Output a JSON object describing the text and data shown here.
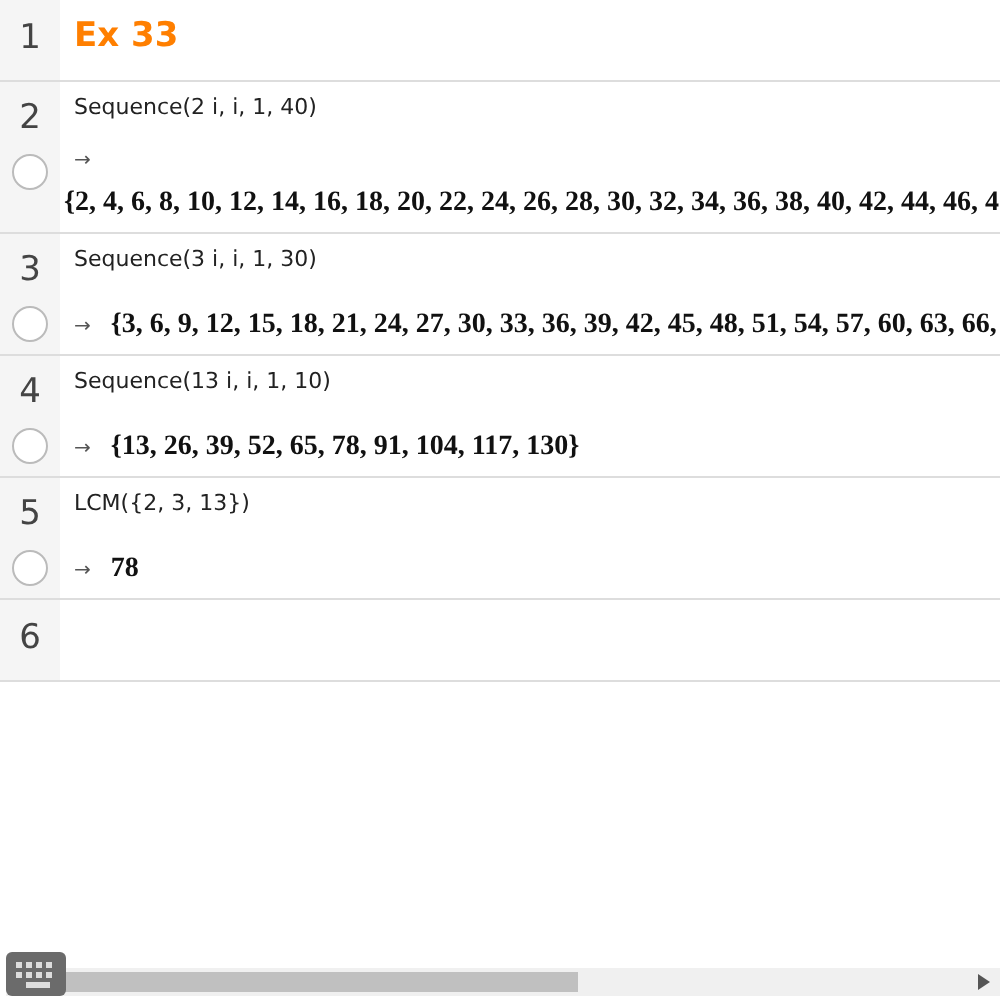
{
  "rows": [
    {
      "number": "1",
      "kind": "text",
      "text": "Ex 33"
    },
    {
      "number": "2",
      "kind": "cas",
      "input": "Sequence(2 i, i, 1, 40)",
      "arrow": "→",
      "output": "{2, 4, 6, 8, 10, 12, 14, 16, 18, 20, 22, 24, 26, 28, 30, 32, 34, 36, 38, 40, 42, 44, 46, 4",
      "output_below": true,
      "plotted": false
    },
    {
      "number": "3",
      "kind": "cas",
      "input": "Sequence(3 i, i, 1, 30)",
      "arrow": "→",
      "output": "{3, 6, 9, 12, 15, 18, 21, 24, 27, 30, 33, 36, 39, 42, 45, 48, 51, 54, 57, 60, 63, 66,",
      "output_below": false,
      "plotted": false
    },
    {
      "number": "4",
      "kind": "cas",
      "input": "Sequence(13 i, i, 1, 10)",
      "arrow": "→",
      "output": "{13, 26, 39, 52, 65, 78, 91, 104, 117, 130}",
      "output_below": false,
      "plotted": false
    },
    {
      "number": "5",
      "kind": "cas",
      "input": "LCM({2, 3, 13})",
      "arrow": "→",
      "output": "78",
      "output_below": false,
      "plotted": false
    },
    {
      "number": "6",
      "kind": "empty"
    }
  ]
}
